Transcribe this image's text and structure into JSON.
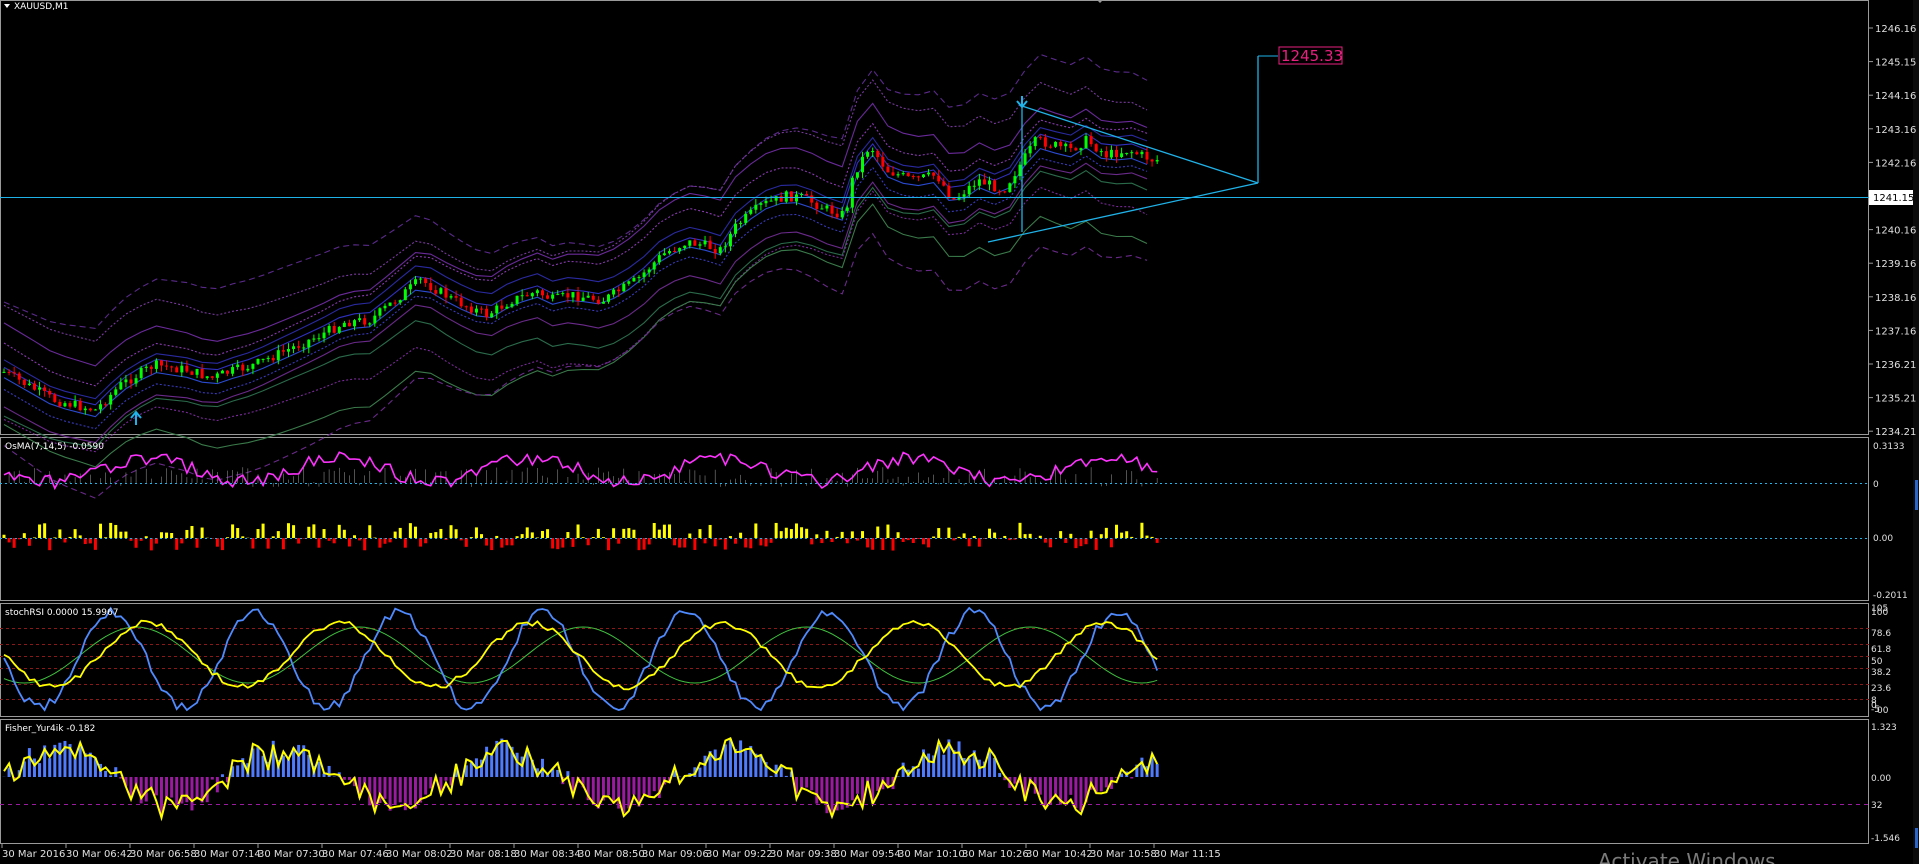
{
  "window": {
    "symbol_title": "XAUUSD,M1",
    "watermark": "Activate Windows"
  },
  "main_chart": {
    "price_axis": [
      "1246.16",
      "1245.15",
      "1244.16",
      "1243.16",
      "1242.16",
      "1241.15",
      "1240.16",
      "1239.16",
      "1238.16",
      "1237.16",
      "1236.21",
      "1235.21",
      "1234.21"
    ],
    "current_price": "1241.15",
    "target_label": "1245.33",
    "colors": {
      "bull": "#00ff00",
      "bear": "#ff0000",
      "trend": "#1fb2e8",
      "target": "#e8217f"
    }
  },
  "osma_panel": {
    "title": "OsMA(7,14,5) -0.0590",
    "axis": [
      "0.3133",
      "0",
      "0.00",
      "-0.2011"
    ],
    "colors": {
      "line": "#ff33ff",
      "up": "#ffff00",
      "down": "#ff0000"
    }
  },
  "stochrsi_panel": {
    "title": "stochRSI 0.0000 15.9967",
    "axis": [
      "105",
      "100",
      "78.6",
      "61.8",
      "50",
      "38.2",
      "23.6",
      "8",
      "0",
      "-5",
      "00"
    ],
    "colors": {
      "fast": "#4f8bff",
      "slow": "#ffff00",
      "signal": "#3fbf3f"
    }
  },
  "fisher_panel": {
    "title": "Fisher_Yur4ik -0.182",
    "axis": [
      "1.323",
      "0.00",
      "32",
      "-1.546"
    ],
    "colors": {
      "line": "#ffff00",
      "pos": "#4f7bff",
      "neg": "#9a1aa0"
    }
  },
  "time_axis": [
    "30 Mar 2016",
    "30 Mar 06:42",
    "30 Mar 06:58",
    "30 Mar 07:14",
    "30 Mar 07:30",
    "30 Mar 07:46",
    "30 Mar 08:02",
    "30 Mar 08:18",
    "30 Mar 08:34",
    "30 Mar 08:50",
    "30 Mar 09:06",
    "30 Mar 09:22",
    "30 Mar 09:38",
    "30 Mar 09:54",
    "30 Mar 10:10",
    "30 Mar 10:26",
    "30 Mar 10:42",
    "30 Mar 10:58",
    "30 Mar 11:15"
  ]
}
